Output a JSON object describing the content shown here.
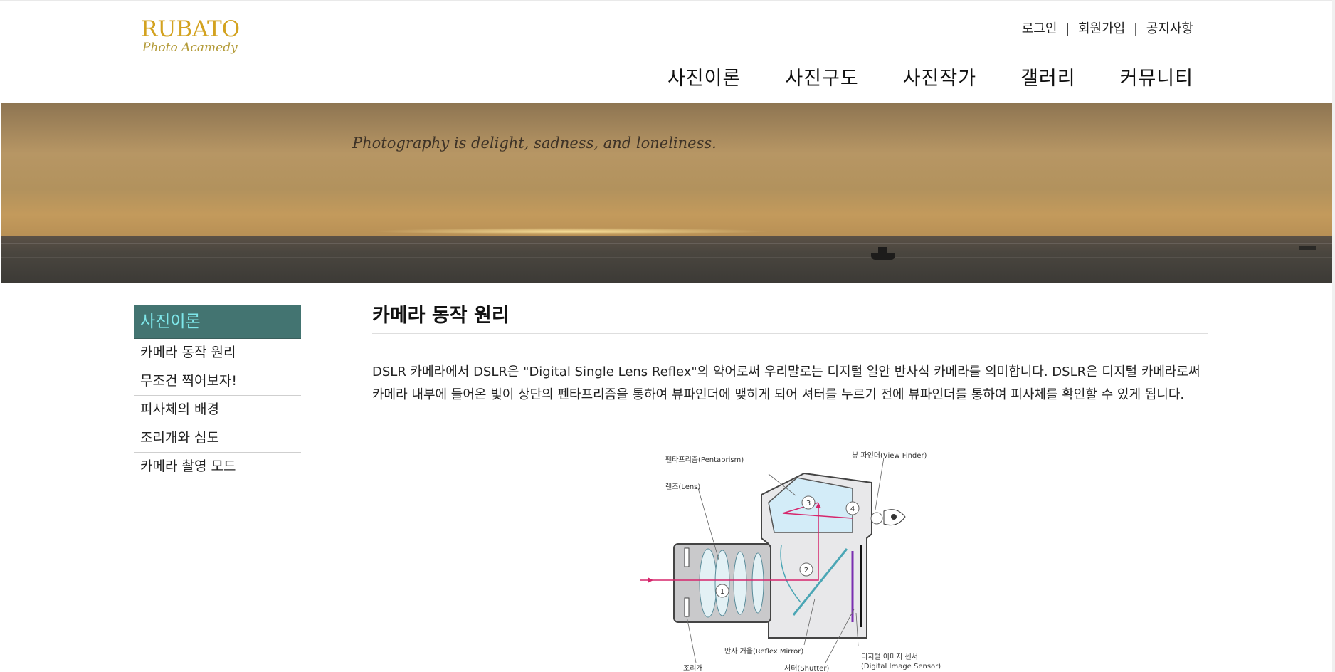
{
  "header": {
    "logo_brand": "RUBATO",
    "logo_sub": "Photo Acamedy",
    "util_links": [
      "로그인",
      "회원가입",
      "공지사항"
    ],
    "util_separator": "|",
    "nav": [
      "사진이론",
      "사진구도",
      "사진작가",
      "갤러리",
      "커뮤니티"
    ]
  },
  "banner": {
    "slogan": "Photography is delight, sadness, and loneliness."
  },
  "sidebar": {
    "title": "사진이론",
    "items": [
      "카메라 동작 원리",
      "무조건 찍어보자!",
      "피사체의 배경",
      "조리개와 심도",
      "카메라 촬영 모드"
    ]
  },
  "content": {
    "title": "카메라 동작 원리",
    "paragraph": "DSLR 카메라에서 DSLR은 \"Digital Single Lens Reflex\"의 약어로써 우리말로는 디지털 일안 반사식 카메라를 의미합니다. DSLR은 디지털 카메라로써 카메라 내부에 들어온 빛이 상단의 펜타프리즘을 통하여 뷰파인더에 맺히게 되어 셔터를 누르기 전에 뷰파인더를 통하여 피사체를 확인할 수 있게 됩니다."
  },
  "diagram": {
    "labels": {
      "pentaprism": "펜타프리즘(Pentaprism)",
      "viewfinder": "뷰 파인더(View Finder)",
      "lens": "렌즈(Lens)",
      "mirror": "반사 거울(Reflex Mirror)",
      "sensor_ko": "디지털 이미지 센서",
      "sensor_en": "(Digital Image Sensor)",
      "aperture": "조리개",
      "shutter": "셔터(Shutter)"
    },
    "markers": [
      "1",
      "2",
      "3",
      "4"
    ]
  },
  "colors": {
    "brand": "#d3a21f",
    "sidebar_title_bg": "#437471",
    "sidebar_title_text": "#7ee7ea",
    "light_ray": "#d6266c",
    "mirror": "#4ba6b5",
    "sensor_line": "#7a2fb0"
  }
}
